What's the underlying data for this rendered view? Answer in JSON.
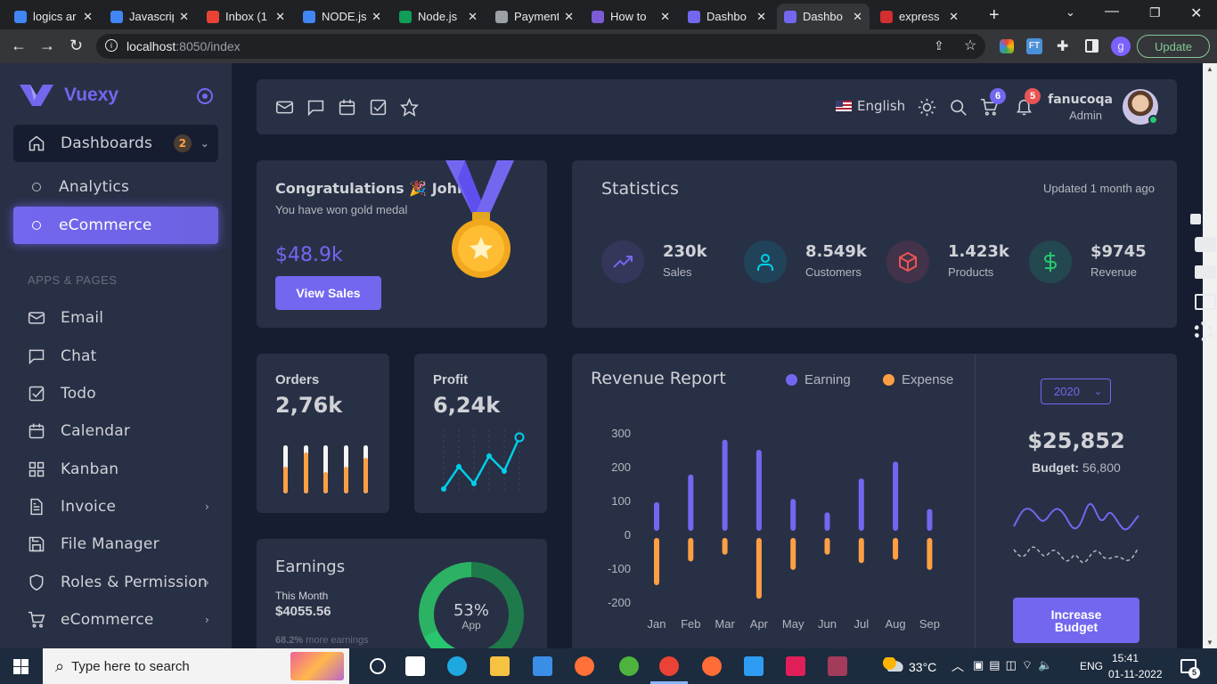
{
  "browser": {
    "tabs": [
      {
        "title": "logics ar",
        "icon": "docs-icon",
        "color": "#4285f4"
      },
      {
        "title": "Javascrip",
        "icon": "docs-icon",
        "color": "#4285f4"
      },
      {
        "title": "Inbox (1",
        "icon": "gmail-icon",
        "color": "#ea4335"
      },
      {
        "title": "NODE.js",
        "icon": "docs-icon",
        "color": "#4285f4"
      },
      {
        "title": "Node.js",
        "icon": "w-icon",
        "color": "#0f9d58"
      },
      {
        "title": "Payment",
        "icon": "globe-icon",
        "color": "#9aa0a6"
      },
      {
        "title": "How to",
        "icon": "a-icon",
        "color": "#7b5cd6"
      },
      {
        "title": "Dashbo",
        "icon": "vuexy-icon",
        "color": "#7367f0"
      },
      {
        "title": "Dashbo",
        "icon": "vuexy-icon",
        "color": "#7367f0"
      },
      {
        "title": "express",
        "icon": "n-icon",
        "color": "#d32f2f"
      }
    ],
    "url_host": "localhost",
    "url_rest": ":8050/index",
    "update_label": "Update",
    "profile_initial": "g"
  },
  "sidebar": {
    "brand": "Vuexy",
    "dashboards": {
      "label": "Dashboards",
      "badge": "2"
    },
    "sub_items": [
      "Analytics",
      "eCommerce"
    ],
    "section_header": "APPS & PAGES",
    "items": [
      {
        "label": "Email",
        "icon": "mail-icon"
      },
      {
        "label": "Chat",
        "icon": "chat-icon"
      },
      {
        "label": "Todo",
        "icon": "todo-icon"
      },
      {
        "label": "Calendar",
        "icon": "calendar-icon"
      },
      {
        "label": "Kanban",
        "icon": "kanban-icon"
      },
      {
        "label": "Invoice",
        "icon": "invoice-icon"
      },
      {
        "label": "File Manager",
        "icon": "save-icon"
      },
      {
        "label": "Roles & Permission",
        "icon": "shield-icon"
      },
      {
        "label": "eCommerce",
        "icon": "cart-icon"
      }
    ]
  },
  "topnav": {
    "language": "English",
    "cart_count": "6",
    "notif_count": "5",
    "user_name": "fanucoqa",
    "user_role": "Admin"
  },
  "congrats": {
    "title": "Congratulations 🎉 John!",
    "subtitle": "You have won gold medal",
    "amount": "$48.9k",
    "button": "View Sales"
  },
  "statistics": {
    "title": "Statistics",
    "updated": "Updated 1 month ago",
    "items": [
      {
        "value": "230k",
        "label": "Sales",
        "color": "#7367f0",
        "bg": "#343759",
        "icon": "trending-up-icon"
      },
      {
        "value": "8.549k",
        "label": "Customers",
        "color": "#00cfe8",
        "bg": "#20435a",
        "icon": "user-icon"
      },
      {
        "value": "1.423k",
        "label": "Products",
        "color": "#ea5455",
        "bg": "#42334a",
        "icon": "box-icon"
      },
      {
        "value": "$9745",
        "label": "Revenue",
        "color": "#28c76f",
        "bg": "#244850",
        "icon": "dollar-icon"
      }
    ]
  },
  "orders": {
    "title": "Orders",
    "value": "2,76k",
    "fills": [
      0.55,
      0.85,
      0.45,
      0.55,
      0.75
    ]
  },
  "profit": {
    "title": "Profit",
    "value": "6,24k"
  },
  "earnings": {
    "title": "Earnings",
    "period": "This Month",
    "amount": "$4055.56",
    "pct": "53%",
    "pct_label": "App",
    "note_pct": "68.2%",
    "note_text": " more earnings"
  },
  "revenue": {
    "title": "Revenue Report",
    "legend": [
      {
        "name": "Earning",
        "color": "#7367f0"
      },
      {
        "name": "Expense",
        "color": "#ff9f43"
      }
    ],
    "year": "2020",
    "total": "$25,852",
    "budget_label": "Budget:",
    "budget_value": " 56,800",
    "button": "Increase Budget"
  },
  "chart_data": {
    "type": "bar",
    "categories": [
      "Jan",
      "Feb",
      "Mar",
      "Apr",
      "May",
      "Jun",
      "Jul",
      "Aug",
      "Sep"
    ],
    "yticks": [
      "300",
      "200",
      "100",
      "0",
      "-100",
      "-200"
    ],
    "ylim": [
      -200,
      300
    ],
    "series": [
      {
        "name": "Earning",
        "color": "#7367f0",
        "values": [
          95,
          177,
          280,
          250,
          105,
          65,
          165,
          215,
          75
        ]
      },
      {
        "name": "Expense",
        "color": "#ff9f43",
        "values": [
          -150,
          -80,
          -60,
          -190,
          -105,
          -60,
          -85,
          -75,
          -105
        ]
      }
    ]
  },
  "taskbar": {
    "search_placeholder": "Type here to search",
    "temperature": "33°C",
    "lang": "ENG",
    "time": "15:41",
    "date": "01-11-2022",
    "notif_count": "5"
  }
}
